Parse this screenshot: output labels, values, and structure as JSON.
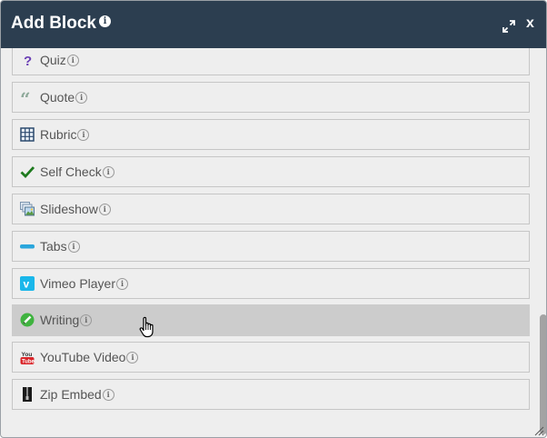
{
  "dialog": {
    "title": "Add Block",
    "title_info": "i",
    "close_label": "x"
  },
  "blocks": [
    {
      "label": "Quiz",
      "icon": "question-icon",
      "info": "i"
    },
    {
      "label": "Quote",
      "icon": "quote-icon",
      "info": "i"
    },
    {
      "label": "Rubric",
      "icon": "grid-icon",
      "info": "i"
    },
    {
      "label": "Self Check",
      "icon": "checkmark-icon",
      "info": "i"
    },
    {
      "label": "Slideshow",
      "icon": "slideshow-icon",
      "info": "i"
    },
    {
      "label": "Tabs",
      "icon": "tabs-icon",
      "info": "i"
    },
    {
      "label": "Vimeo Player",
      "icon": "vimeo-icon",
      "info": "i"
    },
    {
      "label": "Writing",
      "icon": "pencil-icon",
      "info": "i",
      "hovered": true
    },
    {
      "label": "YouTube Video",
      "icon": "youtube-icon",
      "info": "i"
    },
    {
      "label": "Zip Embed",
      "icon": "zip-icon",
      "info": "i"
    }
  ],
  "colors": {
    "titlebar": "#2c3e50",
    "panel": "#eeeeee",
    "hover": "#cccccc",
    "label": "#555555"
  }
}
